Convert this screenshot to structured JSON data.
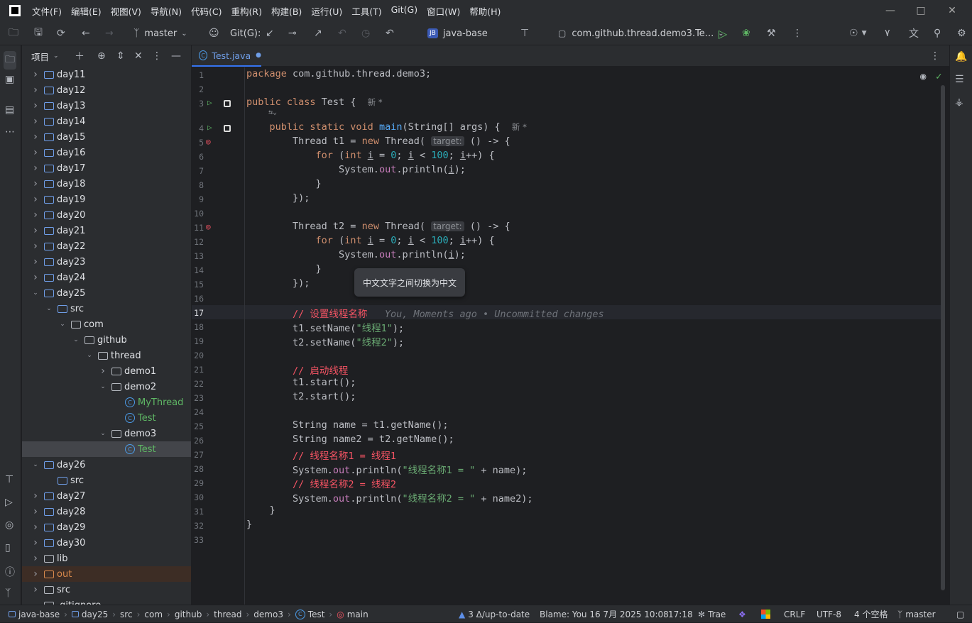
{
  "menu": [
    "文件(F)",
    "编辑(E)",
    "视图(V)",
    "导航(N)",
    "代码(C)",
    "重构(R)",
    "构建(B)",
    "运行(U)",
    "工具(T)",
    "Git(G)",
    "窗口(W)",
    "帮助(H)"
  ],
  "toolbar": {
    "branch": "master",
    "git_label": "Git(G):",
    "project_badge": "JB",
    "project_name": "java-base",
    "run_config": "com.github.thread.demo3.Te..."
  },
  "project_panel": {
    "title": "项目",
    "tree": [
      {
        "label": "day11",
        "depth": 0,
        "kind": "module",
        "expanded": false
      },
      {
        "label": "day12",
        "depth": 0,
        "kind": "module",
        "expanded": false
      },
      {
        "label": "day13",
        "depth": 0,
        "kind": "module",
        "expanded": false
      },
      {
        "label": "day14",
        "depth": 0,
        "kind": "module",
        "expanded": false
      },
      {
        "label": "day15",
        "depth": 0,
        "kind": "module",
        "expanded": false
      },
      {
        "label": "day16",
        "depth": 0,
        "kind": "module",
        "expanded": false
      },
      {
        "label": "day17",
        "depth": 0,
        "kind": "module",
        "expanded": false
      },
      {
        "label": "day18",
        "depth": 0,
        "kind": "module",
        "expanded": false
      },
      {
        "label": "day19",
        "depth": 0,
        "kind": "module",
        "expanded": false
      },
      {
        "label": "day20",
        "depth": 0,
        "kind": "module",
        "expanded": false
      },
      {
        "label": "day21",
        "depth": 0,
        "kind": "module",
        "expanded": false
      },
      {
        "label": "day22",
        "depth": 0,
        "kind": "module",
        "expanded": false
      },
      {
        "label": "day23",
        "depth": 0,
        "kind": "module",
        "expanded": false
      },
      {
        "label": "day24",
        "depth": 0,
        "kind": "module",
        "expanded": false
      },
      {
        "label": "day25",
        "depth": 0,
        "kind": "module",
        "expanded": true
      },
      {
        "label": "src",
        "depth": 1,
        "kind": "src",
        "expanded": true
      },
      {
        "label": "com",
        "depth": 2,
        "kind": "package",
        "expanded": true
      },
      {
        "label": "github",
        "depth": 3,
        "kind": "package",
        "expanded": true
      },
      {
        "label": "thread",
        "depth": 4,
        "kind": "package",
        "expanded": true
      },
      {
        "label": "demo1",
        "depth": 5,
        "kind": "package",
        "expanded": false
      },
      {
        "label": "demo2",
        "depth": 5,
        "kind": "package",
        "expanded": true
      },
      {
        "label": "MyThread",
        "depth": 6,
        "kind": "class"
      },
      {
        "label": "Test",
        "depth": 6,
        "kind": "class"
      },
      {
        "label": "demo3",
        "depth": 5,
        "kind": "package",
        "expanded": true
      },
      {
        "label": "Test",
        "depth": 6,
        "kind": "class",
        "selected": true
      },
      {
        "label": "day26",
        "depth": 0,
        "kind": "module",
        "expanded": true
      },
      {
        "label": "src",
        "depth": 1,
        "kind": "src"
      },
      {
        "label": "day27",
        "depth": 0,
        "kind": "module",
        "expanded": false
      },
      {
        "label": "day28",
        "depth": 0,
        "kind": "module",
        "expanded": false
      },
      {
        "label": "day29",
        "depth": 0,
        "kind": "module",
        "expanded": false
      },
      {
        "label": "day30",
        "depth": 0,
        "kind": "module",
        "expanded": false
      },
      {
        "label": "lib",
        "depth": 0,
        "kind": "folder",
        "expanded": false
      },
      {
        "label": "out",
        "depth": 0,
        "kind": "out",
        "expanded": false
      },
      {
        "label": "src",
        "depth": 0,
        "kind": "folder",
        "expanded": false
      },
      {
        "label": ".gitignore",
        "depth": 0,
        "kind": "file"
      }
    ]
  },
  "editor": {
    "tab_label": "Test.java",
    "tooltip": "中文文字之间切换为中文",
    "blame": "You, Moments ago • Uncommitted changes",
    "new_tag": "新 *",
    "hint_target": "target:",
    "current_line": 17,
    "line_count": 33
  },
  "status": {
    "breadcrumbs": [
      "java-base",
      "day25",
      "src",
      "com",
      "github",
      "thread",
      "demo3",
      "Test",
      "main"
    ],
    "vcs": "3 Δ/up-to-date",
    "blame": "Blame: You 16 7月 2025 10:08",
    "position": "17:18",
    "plugin": "Trae",
    "line_sep": "CRLF",
    "encoding": "UTF-8",
    "indent": "4 个空格",
    "branch": "master"
  },
  "colors": {
    "accent": "#3574f0",
    "keyword": "#cf8e6d",
    "string": "#6aab73",
    "number": "#2aacb8",
    "comment": "#f75464",
    "method": "#56a8f5",
    "field": "#c77dbb"
  }
}
